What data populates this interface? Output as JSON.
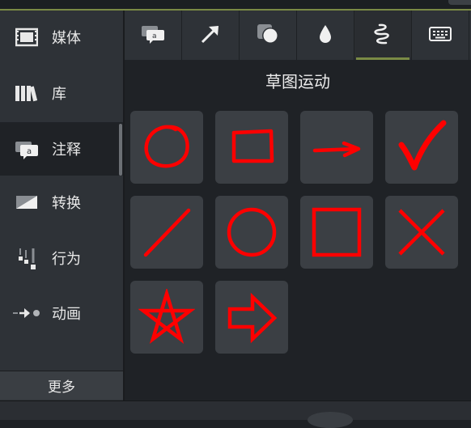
{
  "sidebar": {
    "items": [
      {
        "label": "媒体",
        "icon": "film-icon"
      },
      {
        "label": "库",
        "icon": "library-books-icon"
      },
      {
        "label": "注释",
        "icon": "annotation-callout-icon"
      },
      {
        "label": "转换",
        "icon": "transition-icon"
      },
      {
        "label": "行为",
        "icon": "behavior-icon"
      },
      {
        "label": "动画",
        "icon": "animation-arrow-icon"
      }
    ],
    "active_index": 2,
    "more_label": "更多"
  },
  "tabs": [
    {
      "icon": "callout-icon"
    },
    {
      "icon": "arrow-line-icon"
    },
    {
      "icon": "shapes-icon"
    },
    {
      "icon": "blur-drop-icon"
    },
    {
      "icon": "sketch-motion-icon",
      "active": true
    },
    {
      "icon": "keyboard-icon"
    }
  ],
  "section_title": "草图运动",
  "sketch_tiles": [
    "circle-sketch",
    "rectangle-sketch",
    "arrow-sketch",
    "checkmark-sketch",
    "line-sketch",
    "circle-outline",
    "square-outline",
    "x-cross",
    "star",
    "block-arrow"
  ],
  "colors": {
    "sketch_red": "#ff0000",
    "accent_green": "#7a8a45"
  }
}
